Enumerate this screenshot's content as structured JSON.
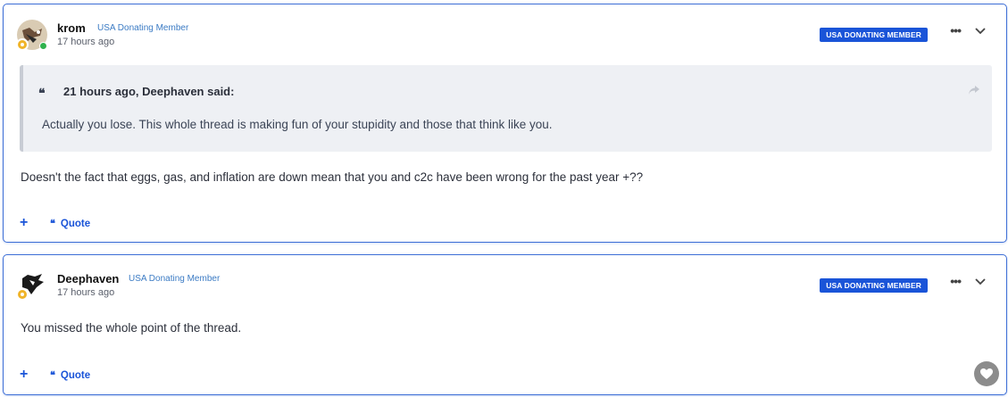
{
  "posts": [
    {
      "author": "krom",
      "member_title": "USA Donating Member",
      "timestamp": "17 hours ago",
      "badge": "USA DONATING MEMBER",
      "quote": {
        "header": "21 hours ago, Deephaven said:",
        "body": "Actually you lose. This whole thread is making fun of your stupidity and those that think like you."
      },
      "text": "Doesn't the fact that eggs, gas, and inflation are down mean that you and c2c have been wrong for the past year +??",
      "actions": {
        "plus": "+",
        "quote": "Quote"
      }
    },
    {
      "author": "Deephaven",
      "member_title": "USA Donating Member",
      "timestamp": "17 hours ago",
      "badge": "USA DONATING MEMBER",
      "text": "You missed the whole point of the thread.",
      "actions": {
        "plus": "+",
        "quote": "Quote"
      }
    }
  ],
  "icons": {
    "more": "ellipsis-icon",
    "expand": "chevron-down-icon",
    "share": "share-arrow-icon",
    "react": "heart-icon",
    "quote_mark": "quote-icon"
  },
  "colors": {
    "accent": "#1a54d8",
    "post_border": "#3d6ed6",
    "member_title": "#3b7bc4",
    "quote_bg": "#eef0f4",
    "online": "#2fb24c",
    "rank": "#f0b429"
  }
}
